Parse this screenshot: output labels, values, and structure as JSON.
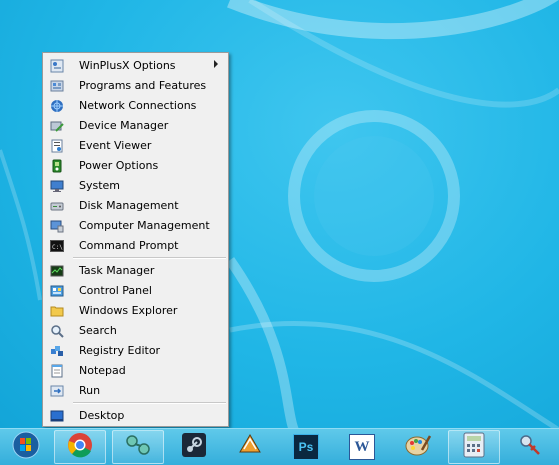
{
  "menu": {
    "items": [
      {
        "label": "WinPlusX Options",
        "icon": "options-icon",
        "submenu": true
      },
      {
        "label": "Programs and Features",
        "icon": "programs-icon"
      },
      {
        "label": "Network Connections",
        "icon": "network-icon"
      },
      {
        "label": "Device Manager",
        "icon": "device-manager-icon"
      },
      {
        "label": "Event Viewer",
        "icon": "event-viewer-icon"
      },
      {
        "label": "Power Options",
        "icon": "power-icon"
      },
      {
        "label": "System",
        "icon": "system-icon"
      },
      {
        "label": "Disk Management",
        "icon": "disk-icon"
      },
      {
        "label": "Computer Management",
        "icon": "computer-management-icon"
      },
      {
        "label": "Command Prompt",
        "icon": "command-prompt-icon"
      },
      {
        "label": "Task Manager",
        "icon": "task-manager-icon"
      },
      {
        "label": "Control Panel",
        "icon": "control-panel-icon"
      },
      {
        "label": "Windows Explorer",
        "icon": "folder-icon"
      },
      {
        "label": "Search",
        "icon": "search-icon"
      },
      {
        "label": "Registry Editor",
        "icon": "registry-icon"
      },
      {
        "label": "Notepad",
        "icon": "notepad-icon"
      },
      {
        "label": "Run",
        "icon": "run-icon"
      },
      {
        "label": "Desktop",
        "icon": "desktop-icon"
      }
    ]
  },
  "taskbar": {
    "items": [
      {
        "icon": "start-orb-icon"
      },
      {
        "icon": "chrome-icon"
      },
      {
        "icon": "network-tool-icon"
      },
      {
        "icon": "steam-icon"
      },
      {
        "icon": "winamp-icon"
      },
      {
        "icon": "photoshop-icon",
        "text": "Ps"
      },
      {
        "icon": "word-icon",
        "text": "W"
      },
      {
        "icon": "paint-icon"
      },
      {
        "icon": "calculator-icon"
      },
      {
        "icon": "snipping-tool-icon"
      }
    ]
  }
}
